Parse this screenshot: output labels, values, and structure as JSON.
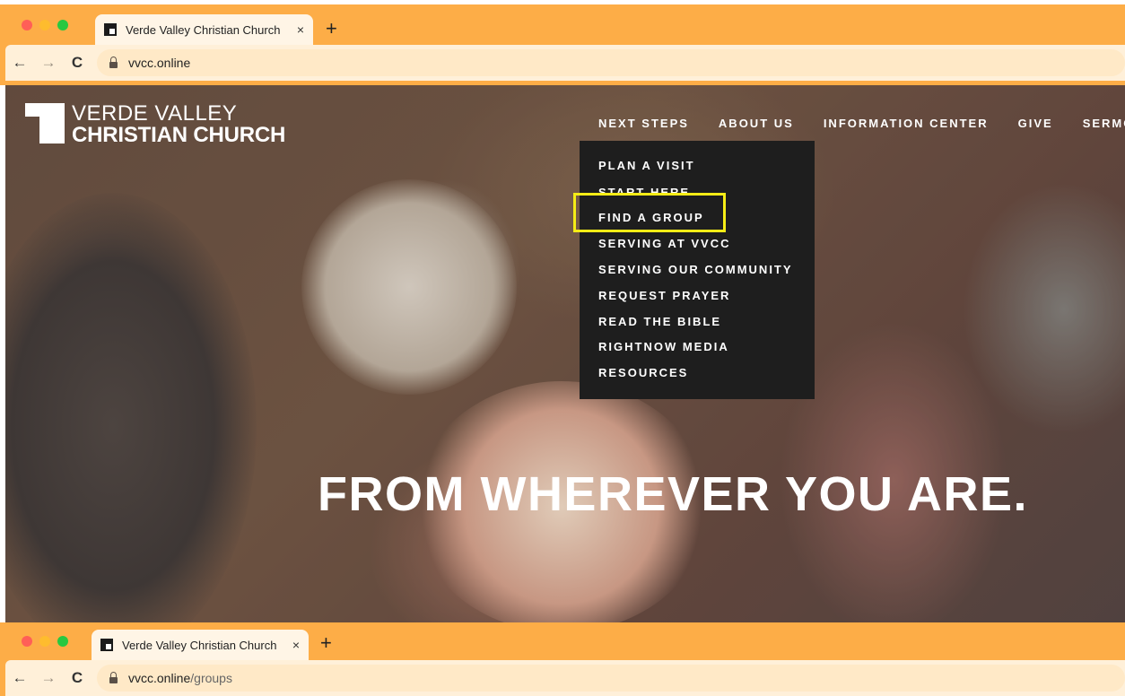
{
  "browser_top": {
    "tab_title": "Verde Valley Christian Church",
    "tab_close": "×",
    "new_tab": "+",
    "back": "←",
    "forward": "→",
    "reload": "C",
    "url": "vvcc.online",
    "url_path": ""
  },
  "browser_bottom": {
    "tab_title": "Verde Valley Christian Church -",
    "tab_close": "×",
    "new_tab": "+",
    "back": "←",
    "forward": "→",
    "reload": "C",
    "url": "vvcc.online",
    "url_path": "/groups"
  },
  "site": {
    "logo_line1": "VERDE VALLEY",
    "logo_line2": "CHRISTIAN CHURCH",
    "nav": [
      "NEXT STEPS",
      "ABOUT US",
      "INFORMATION CENTER",
      "GIVE",
      "SERMO"
    ],
    "dropdown": [
      "PLAN A VISIT",
      "START HERE",
      "FIND A GROUP",
      "SERVING AT VVCC",
      "SERVING OUR COMMUNITY",
      "REQUEST PRAYER",
      "READ THE BIBLE",
      "RIGHTNOW MEDIA",
      "RESOURCES"
    ],
    "highlighted_item": "FIND A GROUP",
    "headline": "FROM WHEREVER YOU ARE."
  },
  "colors": {
    "chrome": "#fdad47",
    "highlight": "#f5ec16",
    "dropdown_bg": "#1e1e1e"
  }
}
